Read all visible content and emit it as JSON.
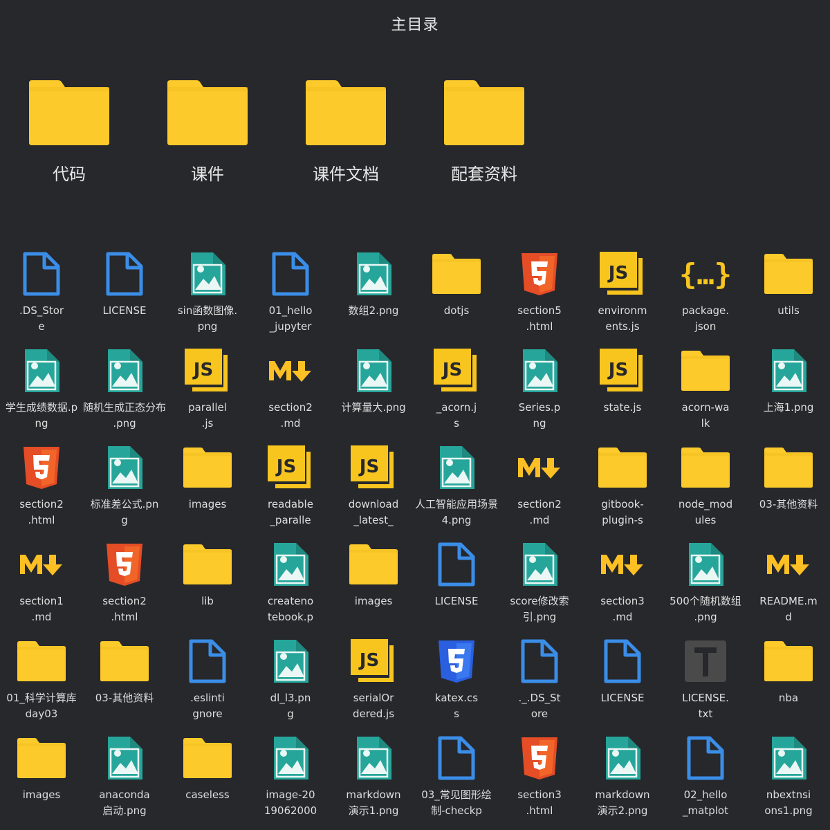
{
  "title": "主目录",
  "colors": {
    "background": "#27282c",
    "folder": "#fcca2b",
    "doc_blue": "#3b8ee8",
    "image_teal": "#26a69a",
    "html_red": "#e44d26",
    "js_yellow": "#f7c51e",
    "md_yellow": "#fcc024",
    "css_blue": "#2a5fe0"
  },
  "top_folders": [
    {
      "label": "代码",
      "icon": "folder-icon"
    },
    {
      "label": "课件",
      "icon": "folder-icon"
    },
    {
      "label": "课件文档",
      "icon": "folder-icon"
    },
    {
      "label": "配套资料",
      "icon": "folder-icon"
    }
  ],
  "files": [
    {
      "l1": ".DS_Stor",
      "l2": "e",
      "icon": "doc"
    },
    {
      "l1": "LICENSE",
      "l2": "",
      "icon": "doc"
    },
    {
      "l1": "sin函数图像.",
      "l2": "png",
      "icon": "image"
    },
    {
      "l1": "01_hello",
      "l2": "_jupyter",
      "icon": "doc"
    },
    {
      "l1": "数组2.png",
      "l2": "",
      "icon": "image"
    },
    {
      "l1": "dotjs",
      "l2": "",
      "icon": "folder"
    },
    {
      "l1": "section5",
      "l2": ".html",
      "icon": "html"
    },
    {
      "l1": "environm",
      "l2": "ents.js",
      "icon": "js"
    },
    {
      "l1": "package.",
      "l2": "json",
      "icon": "json"
    },
    {
      "l1": "utils",
      "l2": "",
      "icon": "folder"
    },
    {
      "l1": "学生成绩数据.p",
      "l2": "ng",
      "icon": "image"
    },
    {
      "l1": "随机生成正态分布",
      "l2": ".png",
      "icon": "image"
    },
    {
      "l1": "parallel",
      "l2": ".js",
      "icon": "js"
    },
    {
      "l1": "section2",
      "l2": ".md",
      "icon": "md"
    },
    {
      "l1": "计算量大.png",
      "l2": "",
      "icon": "image"
    },
    {
      "l1": "_acorn.j",
      "l2": "s",
      "icon": "js"
    },
    {
      "l1": "Series.p",
      "l2": "ng",
      "icon": "image"
    },
    {
      "l1": "state.js",
      "l2": "",
      "icon": "js"
    },
    {
      "l1": "acorn-wa",
      "l2": "lk",
      "icon": "folder"
    },
    {
      "l1": "上海1.png",
      "l2": "",
      "icon": "image"
    },
    {
      "l1": "section2",
      "l2": ".html",
      "icon": "html"
    },
    {
      "l1": "标准差公式.pn",
      "l2": "g",
      "icon": "image"
    },
    {
      "l1": "images",
      "l2": "",
      "icon": "folder"
    },
    {
      "l1": "readable",
      "l2": "_paralle",
      "icon": "js"
    },
    {
      "l1": "download",
      "l2": "_latest_",
      "icon": "js"
    },
    {
      "l1": "人工智能应用场景",
      "l2": "4.png",
      "icon": "image"
    },
    {
      "l1": "section2",
      "l2": ".md",
      "icon": "md"
    },
    {
      "l1": "gitbook-",
      "l2": "plugin-s",
      "icon": "folder"
    },
    {
      "l1": "node_mod",
      "l2": "ules",
      "icon": "folder"
    },
    {
      "l1": "03-其他资料",
      "l2": "",
      "icon": "folder"
    },
    {
      "l1": "section1",
      "l2": ".md",
      "icon": "md"
    },
    {
      "l1": "section2",
      "l2": ".html",
      "icon": "html"
    },
    {
      "l1": "lib",
      "l2": "",
      "icon": "folder"
    },
    {
      "l1": "createno",
      "l2": "tebook.p",
      "icon": "image"
    },
    {
      "l1": "images",
      "l2": "",
      "icon": "folder"
    },
    {
      "l1": "LICENSE",
      "l2": "",
      "icon": "doc"
    },
    {
      "l1": "score修改索",
      "l2": "引.png",
      "icon": "image"
    },
    {
      "l1": "section3",
      "l2": ".md",
      "icon": "md"
    },
    {
      "l1": "500个随机数组",
      "l2": ".png",
      "icon": "image"
    },
    {
      "l1": "README.m",
      "l2": "d",
      "icon": "md"
    },
    {
      "l1": "01_科学计算库",
      "l2": "day03",
      "icon": "folder"
    },
    {
      "l1": "03-其他资料",
      "l2": "",
      "icon": "folder"
    },
    {
      "l1": ".eslinti",
      "l2": "gnore",
      "icon": "doc"
    },
    {
      "l1": "dl_l3.pn",
      "l2": "g",
      "icon": "image"
    },
    {
      "l1": "serialOr",
      "l2": "dered.js",
      "icon": "js"
    },
    {
      "l1": "katex.cs",
      "l2": "s",
      "icon": "css"
    },
    {
      "l1": "._.DS_St",
      "l2": "ore",
      "icon": "doc"
    },
    {
      "l1": "LICENSE",
      "l2": "",
      "icon": "doc"
    },
    {
      "l1": "LICENSE.",
      "l2": "txt",
      "icon": "txt"
    },
    {
      "l1": "nba",
      "l2": "",
      "icon": "folder"
    },
    {
      "l1": "images",
      "l2": "",
      "icon": "folder"
    },
    {
      "l1": "anaconda",
      "l2": "启动.png",
      "icon": "image"
    },
    {
      "l1": "caseless",
      "l2": "",
      "icon": "folder"
    },
    {
      "l1": "image-20",
      "l2": "19062000",
      "icon": "image"
    },
    {
      "l1": "markdown",
      "l2": "演示1.png",
      "icon": "image"
    },
    {
      "l1": "03_常见图形绘",
      "l2": "制-checkp",
      "icon": "doc"
    },
    {
      "l1": "section3",
      "l2": ".html",
      "icon": "html"
    },
    {
      "l1": "markdown",
      "l2": "演示2.png",
      "icon": "image"
    },
    {
      "l1": "02_hello",
      "l2": "_matplot",
      "icon": "doc"
    },
    {
      "l1": "nbextnsi",
      "l2": "ons1.png",
      "icon": "image"
    }
  ]
}
